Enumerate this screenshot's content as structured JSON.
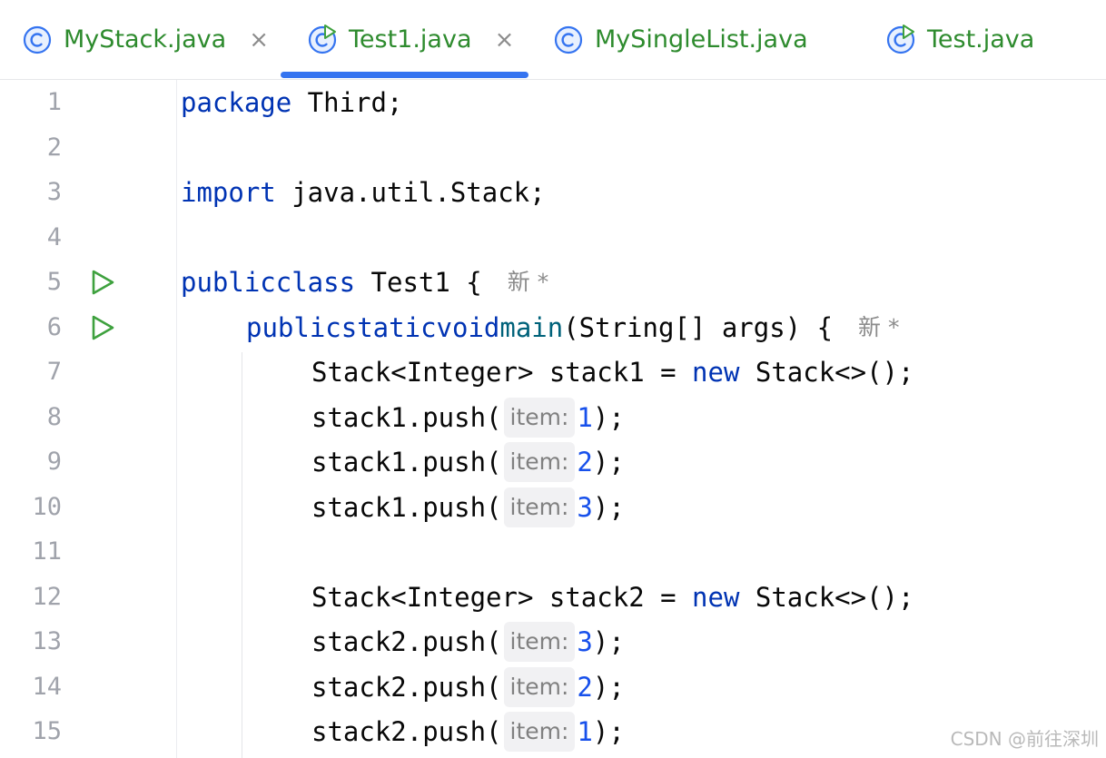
{
  "tabs": [
    {
      "label": "MyStack.java",
      "icon": "class-icon",
      "closable": true,
      "active": false
    },
    {
      "label": "Test1.java",
      "icon": "runnable-class-icon",
      "closable": true,
      "active": true
    },
    {
      "label": "MySingleList.java",
      "icon": "class-icon",
      "closable": false,
      "active": false
    },
    {
      "label": "Test.java",
      "icon": "runnable-class-icon",
      "closable": false,
      "active": false
    }
  ],
  "tab_close_glyph": "×",
  "colors": {
    "tab_text": "#2e8b2e",
    "active_underline": "#3574f0",
    "keyword": "#0033b3",
    "method": "#00627a",
    "number": "#1750eb",
    "run_icon": "#3ea13e",
    "line_number": "#a0a3ab"
  },
  "editor": {
    "line_numbers": [
      "1",
      "2",
      "3",
      "4",
      "5",
      "6",
      "7",
      "8",
      "9",
      "10",
      "11",
      "12",
      "13",
      "14",
      "15"
    ],
    "lines": {
      "l1": {
        "kw": "package",
        "rest": " Third;"
      },
      "l3": {
        "kw": "import",
        "rest": " java.util.Stack;"
      },
      "l5": {
        "kw1": "public",
        "kw2": "class",
        "rest": " Test1 {",
        "author": "新 *"
      },
      "l6": {
        "kw1": "public",
        "kw2": "static",
        "kw3": "void",
        "fn": "main",
        "rest": "(String[] args) {",
        "author": "新 *"
      },
      "l7": {
        "pre": "Stack<Integer> stack1 = ",
        "kw": "new",
        "post": " Stack<>();"
      },
      "l8": {
        "pre": "stack1.push(",
        "hint": "item:",
        "num": "1",
        "post": ");"
      },
      "l9": {
        "pre": "stack1.push(",
        "hint": "item:",
        "num": "2",
        "post": ");"
      },
      "l10": {
        "pre": "stack1.push(",
        "hint": "item:",
        "num": "3",
        "post": ");"
      },
      "l12": {
        "pre": "Stack<Integer> stack2 = ",
        "kw": "new",
        "post": " Stack<>();"
      },
      "l13": {
        "pre": "stack2.push(",
        "hint": "item:",
        "num": "3",
        "post": ");"
      },
      "l14": {
        "pre": "stack2.push(",
        "hint": "item:",
        "num": "2",
        "post": ");"
      },
      "l15": {
        "pre": "stack2.push(",
        "hint": "item:",
        "num": "1",
        "post": ");"
      }
    }
  },
  "run_gutter_icons": [
    "run-main-class-icon",
    "run-main-method-icon"
  ],
  "watermark": "CSDN @前往深圳"
}
